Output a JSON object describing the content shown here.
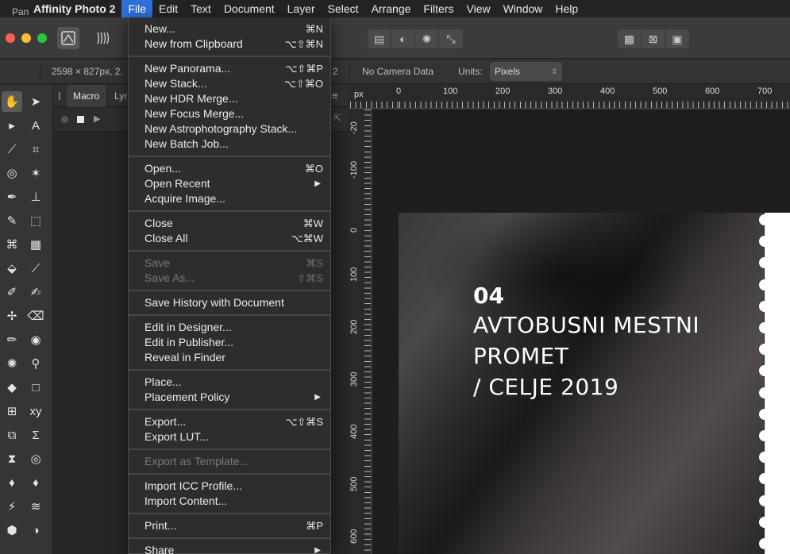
{
  "menubar": {
    "app_name": "Affinity Photo 2",
    "items": [
      "File",
      "Edit",
      "Text",
      "Document",
      "Layer",
      "Select",
      "Arrange",
      "Filters",
      "View",
      "Window",
      "Help"
    ],
    "active": "File"
  },
  "context_bar": {
    "tool": "Pan",
    "doc_size": "2598 × 827px, 2.",
    "hidden_suffix": "2",
    "camera": "No Camera Data",
    "units_label": "Units:",
    "units_value": "Pixels"
  },
  "studio": {
    "tabs": [
      "Macro",
      "Lyr"
    ]
  },
  "ruler": {
    "unit": "px",
    "top_labels": [
      "0",
      "100",
      "200",
      "300",
      "400",
      "500",
      "600",
      "700"
    ],
    "left_labels": [
      "-20",
      "-100",
      "0",
      "100",
      "200",
      "300",
      "400",
      "500",
      "600"
    ]
  },
  "poster": {
    "number": "04",
    "line1": "AVTOBUSNI MESTNI",
    "line2": "PROMET",
    "line3": "/ CELJE 2019"
  },
  "file_menu": {
    "groups": [
      [
        {
          "label": "New...",
          "shortcut": "⌘N"
        },
        {
          "label": "New from Clipboard",
          "shortcut": "⌥⇧⌘N"
        }
      ],
      [
        {
          "label": "New Panorama...",
          "shortcut": "⌥⇧⌘P"
        },
        {
          "label": "New Stack...",
          "shortcut": "⌥⇧⌘O"
        },
        {
          "label": "New HDR Merge...",
          "shortcut": ""
        },
        {
          "label": "New Focus Merge...",
          "shortcut": ""
        },
        {
          "label": "New Astrophotography Stack...",
          "shortcut": ""
        },
        {
          "label": "New Batch Job...",
          "shortcut": ""
        }
      ],
      [
        {
          "label": "Open...",
          "shortcut": "⌘O"
        },
        {
          "label": "Open Recent",
          "shortcut": "",
          "submenu": true
        },
        {
          "label": "Acquire Image...",
          "shortcut": ""
        }
      ],
      [
        {
          "label": "Close",
          "shortcut": "⌘W"
        },
        {
          "label": "Close All",
          "shortcut": "⌥⌘W"
        }
      ],
      [
        {
          "label": "Save",
          "shortcut": "⌘S",
          "disabled": true
        },
        {
          "label": "Save As...",
          "shortcut": "⇧⌘S",
          "disabled": true
        }
      ],
      [
        {
          "label": "Save History with Document",
          "shortcut": ""
        }
      ],
      [
        {
          "label": "Edit in Designer...",
          "shortcut": ""
        },
        {
          "label": "Edit in Publisher...",
          "shortcut": ""
        },
        {
          "label": "Reveal in Finder",
          "shortcut": ""
        }
      ],
      [
        {
          "label": "Place...",
          "shortcut": ""
        },
        {
          "label": "Placement Policy",
          "shortcut": "",
          "submenu": true
        }
      ],
      [
        {
          "label": "Export...",
          "shortcut": "⌥⇧⌘S"
        },
        {
          "label": "Export LUT...",
          "shortcut": ""
        }
      ],
      [
        {
          "label": "Export as Template...",
          "shortcut": "",
          "disabled": true
        }
      ],
      [
        {
          "label": "Import ICC Profile...",
          "shortcut": ""
        },
        {
          "label": "Import Content...",
          "shortcut": ""
        }
      ],
      [
        {
          "label": "Print...",
          "shortcut": "⌘P"
        }
      ],
      [
        {
          "label": "Share",
          "shortcut": "",
          "submenu": true
        }
      ]
    ]
  },
  "colors": {
    "menu_highlight": "#2f6fd6",
    "close_button": "#ff5f57",
    "minimize_button": "#febc2e",
    "zoom_button": "#28c840"
  }
}
